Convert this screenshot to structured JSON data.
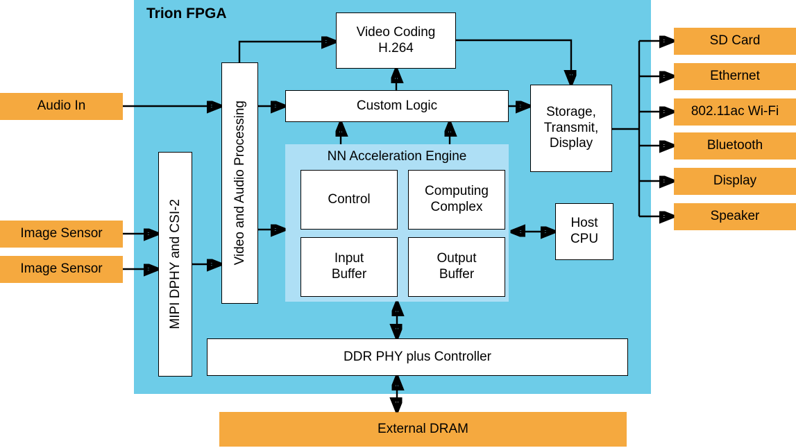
{
  "diagram": {
    "title": "Trion FPGA",
    "colors": {
      "fpga_fill": "#6DCCE8",
      "external_fill": "#F5A93F",
      "nn_engine_fill": "#AEDFF5",
      "block_fill": "#FFFFFF",
      "line": "#000000"
    }
  },
  "inputs": {
    "audio_in": "Audio In",
    "image_sensor_1": "Image Sensor",
    "image_sensor_2": "Image Sensor"
  },
  "fpga_blocks": {
    "mipi": "MIPI DPHY and CSI-2",
    "video_audio": "Video and Audio Processing",
    "video_coding": "Video Coding\nH.264",
    "video_coding_line1": "Video Coding",
    "video_coding_line2": "H.264",
    "custom_logic": "Custom Logic",
    "storage": "Storage,\nTransmit,\nDisplay",
    "storage_line1": "Storage,",
    "storage_line2": "Transmit,",
    "storage_line3": "Display",
    "host_cpu_line1": "Host",
    "host_cpu_line2": "CPU",
    "ddr_phy": "DDR PHY plus Controller"
  },
  "nn_engine": {
    "title": "NN Acceleration Engine",
    "cells": [
      {
        "id": "control",
        "label": "Control"
      },
      {
        "id": "computing-complex",
        "line1": "Computing",
        "line2": "Complex"
      },
      {
        "id": "input-buffer",
        "line1": "Input",
        "line2": "Buffer"
      },
      {
        "id": "output-buffer",
        "line1": "Output",
        "line2": "Buffer"
      }
    ]
  },
  "outputs": {
    "peripherals": [
      {
        "id": "sd-card",
        "label": "SD Card"
      },
      {
        "id": "ethernet",
        "label": "Ethernet"
      },
      {
        "id": "wifi",
        "label": "802.11ac Wi-Fi"
      },
      {
        "id": "bluetooth",
        "label": "Bluetooth"
      },
      {
        "id": "display",
        "label": "Display"
      },
      {
        "id": "speaker",
        "label": "Speaker"
      }
    ]
  },
  "memory": {
    "external_dram": "External DRAM"
  }
}
